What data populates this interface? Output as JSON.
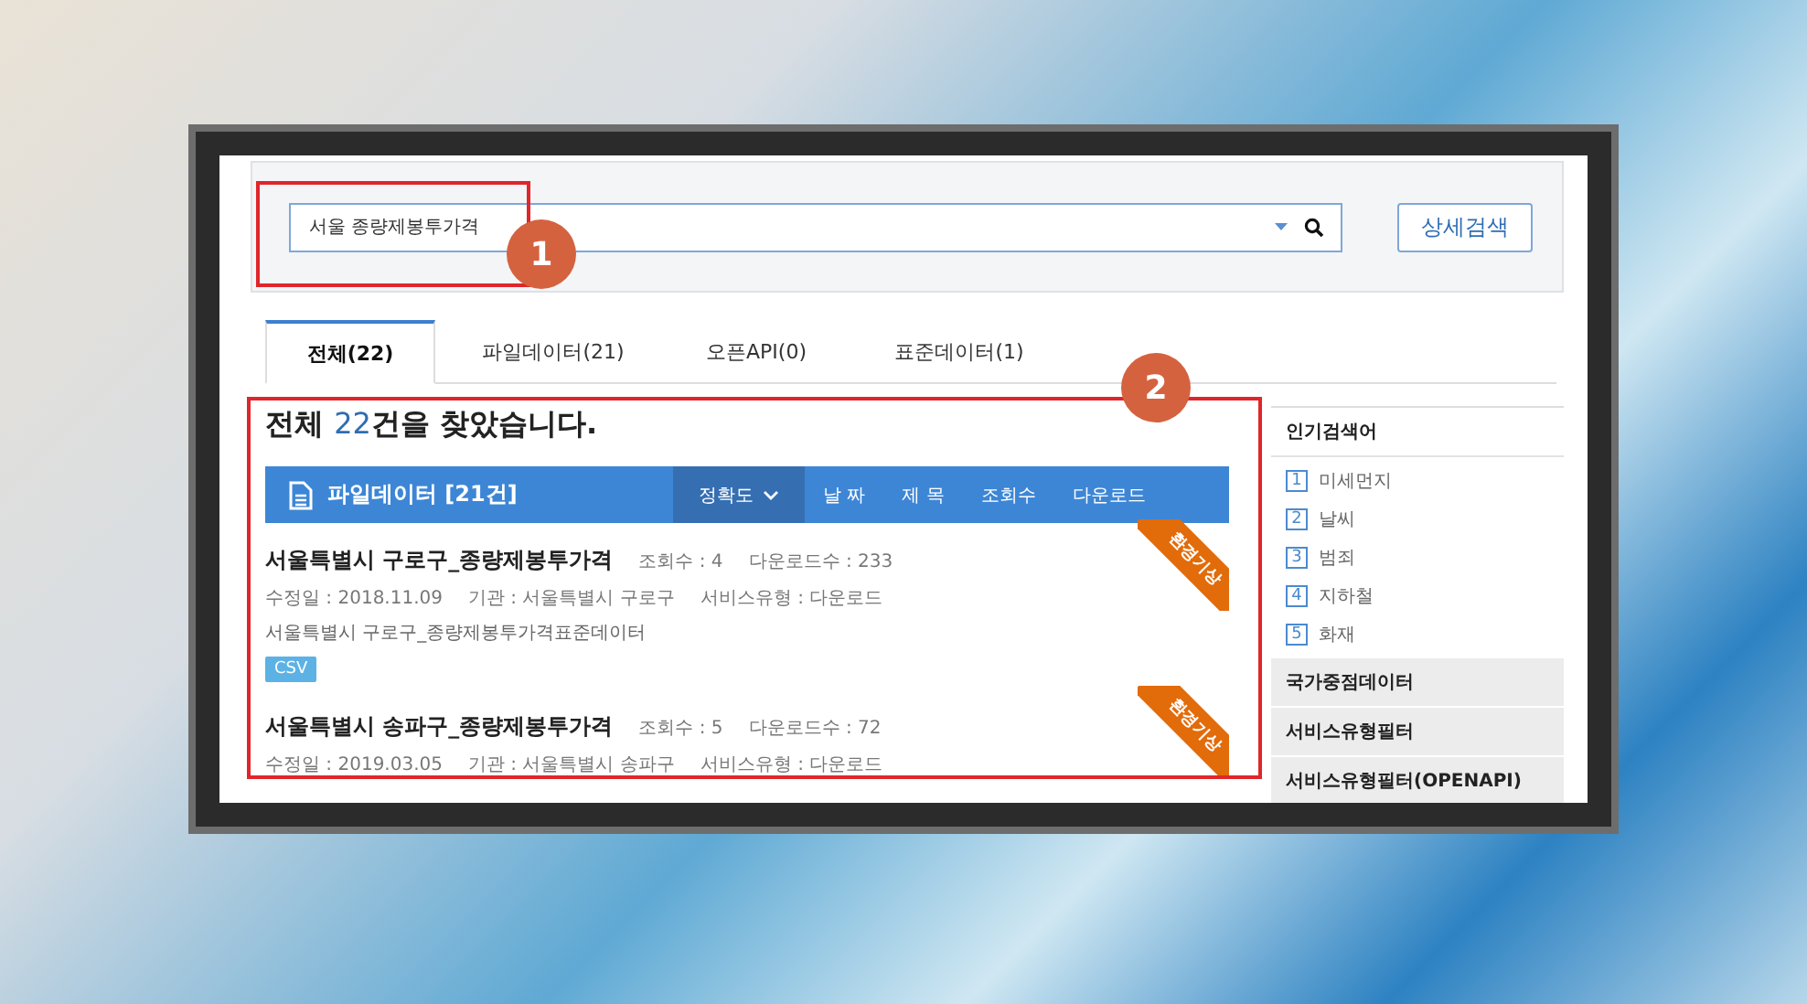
{
  "search": {
    "value": "서울 종량제봉투가격",
    "button": "상세검색"
  },
  "tabs": [
    {
      "label": "전체(22)",
      "selected": true
    },
    {
      "label": "파일데이터(21)",
      "selected": false
    },
    {
      "label": "오픈API(0)",
      "selected": false
    },
    {
      "label": "표준데이터(1)",
      "selected": false
    }
  ],
  "result_heading": {
    "prefix": "전체 ",
    "count": "22",
    "suffix": "건을 찾았습니다."
  },
  "section_bar": {
    "title": "파일데이터 [21건]",
    "sort_options": [
      {
        "label": "정확도",
        "selected": true
      },
      {
        "label": "날 짜",
        "selected": false
      },
      {
        "label": "제 목",
        "selected": false
      },
      {
        "label": "조회수",
        "selected": false
      },
      {
        "label": "다운로드",
        "selected": false
      }
    ]
  },
  "results": [
    {
      "title": "서울특별시 구로구_종량제봉투가격",
      "views": "조회수 : 4",
      "downloads": "다운로드수 : 233",
      "modified": "수정일 : 2018.11.09",
      "agency": "기관 : 서울특별시 구로구",
      "service_type": "서비스유형 : 다운로드",
      "description": "서울특별시 구로구_종량제봉투가격표준데이터",
      "format": "CSV",
      "ribbon": "환경기상"
    },
    {
      "title": "서울특별시 송파구_종량제봉투가격",
      "views": "조회수 : 5",
      "downloads": "다운로드수 : 72",
      "modified": "수정일 : 2019.03.05",
      "agency": "기관 : 서울특별시 송파구",
      "service_type": "서비스유형 : 다운로드",
      "ribbon": "환경기상"
    }
  ],
  "sidebar": {
    "popular_title": "인기검색어",
    "popular": [
      {
        "rank": "1",
        "text": "미세먼지"
      },
      {
        "rank": "2",
        "text": "날씨"
      },
      {
        "rank": "3",
        "text": "범죄"
      },
      {
        "rank": "4",
        "text": "지하철"
      },
      {
        "rank": "5",
        "text": "화재"
      }
    ],
    "filters": [
      "국가중점데이터",
      "서비스유형필터",
      "서비스유형필터(OPENAPI)"
    ]
  },
  "annotations": [
    {
      "label": "1"
    },
    {
      "label": "2"
    }
  ]
}
